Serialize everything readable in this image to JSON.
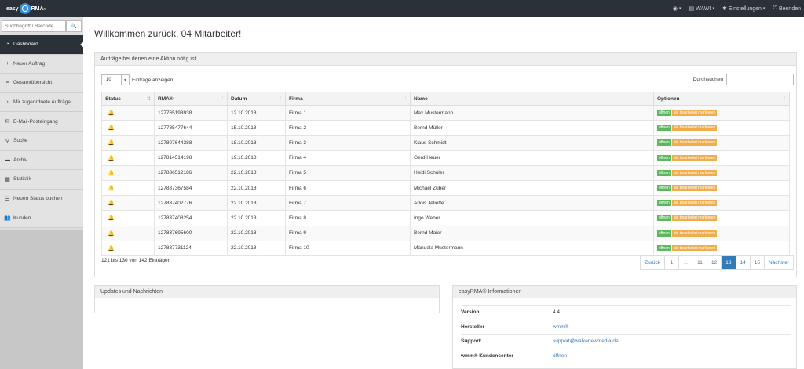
{
  "topbar": {
    "logo_left": "easy",
    "logo_right": "RMA",
    "logo_reg": "®",
    "nav": [
      {
        "icon": "globe-icon",
        "glyph": "◉",
        "label": "",
        "caret": "▾"
      },
      {
        "icon": "warehouse-icon",
        "glyph": "▤",
        "label": "WAWI",
        "caret": "▾"
      },
      {
        "icon": "gear-icon",
        "glyph": "✱",
        "label": "Einstellungen",
        "caret": "▾"
      },
      {
        "icon": "power-icon",
        "glyph": "⏻",
        "label": "Beenden",
        "caret": ""
      }
    ]
  },
  "sidebar": {
    "search_placeholder": "Suchbegriff / Barcode",
    "search_icon": "🔍",
    "items": [
      {
        "label": "Dashboard",
        "icon": "dashboard-icon",
        "glyph": "◔"
      },
      {
        "label": "Neuer Auftrag",
        "icon": "plus-icon",
        "glyph": "+"
      },
      {
        "label": "Gesamtübersicht",
        "icon": "list-icon",
        "glyph": "≡"
      },
      {
        "label": "Mir zugeordnete Aufträge",
        "icon": "chevron-right-icon",
        "glyph": "›"
      },
      {
        "label": "E-Mail-Posteingang",
        "icon": "envelope-icon",
        "glyph": "✉"
      },
      {
        "label": "Suche",
        "icon": "search-icon",
        "glyph": "⚲"
      },
      {
        "label": "Archiv",
        "icon": "archive-icon",
        "glyph": "▬"
      },
      {
        "label": "Statistik",
        "icon": "chart-icon",
        "glyph": "▦"
      },
      {
        "label": "Neuen Status buchen",
        "icon": "list-icon",
        "glyph": "☰"
      },
      {
        "label": "Kunden",
        "icon": "users-icon",
        "glyph": "👥"
      }
    ]
  },
  "main": {
    "title": "Willkommen zurück, 04 Mitarbeiter!",
    "orders_panel": {
      "title": "Aufträge bei denen eine Aktion nötig ist",
      "length_value": "10",
      "length_label": "Einträge anzeigen",
      "search_label": "Durchsuchen",
      "columns": [
        "Status",
        "RMA®",
        "Datum",
        "Firma",
        "Name",
        "Optionen"
      ],
      "rows": [
        {
          "rma": "127765193938",
          "datum": "12.10.2018",
          "firma": "Firma 1",
          "name": "Max Mustermann"
        },
        {
          "rma": "127785477644",
          "datum": "15.10.2018",
          "firma": "Firma 2",
          "name": "Bernd Müller"
        },
        {
          "rma": "127807644288",
          "datum": "18.10.2018",
          "firma": "Firma 3",
          "name": "Klaus Schmidt"
        },
        {
          "rma": "127814514198",
          "datum": "19.10.2018",
          "firma": "Firma 4",
          "name": "Gerd Heuer"
        },
        {
          "rma": "127836512186",
          "datum": "22.10.2018",
          "firma": "Firma 5",
          "name": "Heidi Schuler"
        },
        {
          "rma": "127837367584",
          "datum": "22.10.2018",
          "firma": "Firma 6",
          "name": "Michael Zuber"
        },
        {
          "rma": "127837402776",
          "datum": "22.10.2018",
          "firma": "Firma 7",
          "name": "Arlois Jeliette"
        },
        {
          "rma": "127837408254",
          "datum": "22.10.2018",
          "firma": "Firma 8",
          "name": "Ingo Weber"
        },
        {
          "rma": "127837695600",
          "datum": "22.10.2018",
          "firma": "Firma 9",
          "name": "Bernd Maier"
        },
        {
          "rma": "127837731124",
          "datum": "22.10.2018",
          "firma": "Firma 10",
          "name": "Manuela Mustermann"
        }
      ],
      "open_label": "öffnen",
      "mark_label": "als bearbeitet markieren",
      "info": "121 bis 130 von 142 Einträgen",
      "pager": [
        "Zurück",
        "1",
        "...",
        "11",
        "12",
        "13",
        "14",
        "15",
        "Nächster"
      ],
      "pager_active": "13"
    },
    "news_panel": {
      "title": "Updates und Nachrichten"
    },
    "info_panel": {
      "title": "easyRMA® Informationen",
      "rows": [
        {
          "key": "Version",
          "value": "4.4",
          "link": false
        },
        {
          "key": "Hersteller",
          "value": "wmm®",
          "link": true
        },
        {
          "key": "Support",
          "value": "support@walkenewmedia.de",
          "link": true
        },
        {
          "key": "wmm® Kundencenter",
          "value": "öffnen",
          "link": true
        }
      ]
    }
  },
  "colors": {
    "topbar": "#2b3138",
    "accent": "#337ab7",
    "success": "#5cb85c",
    "warning": "#f0ad4e"
  }
}
